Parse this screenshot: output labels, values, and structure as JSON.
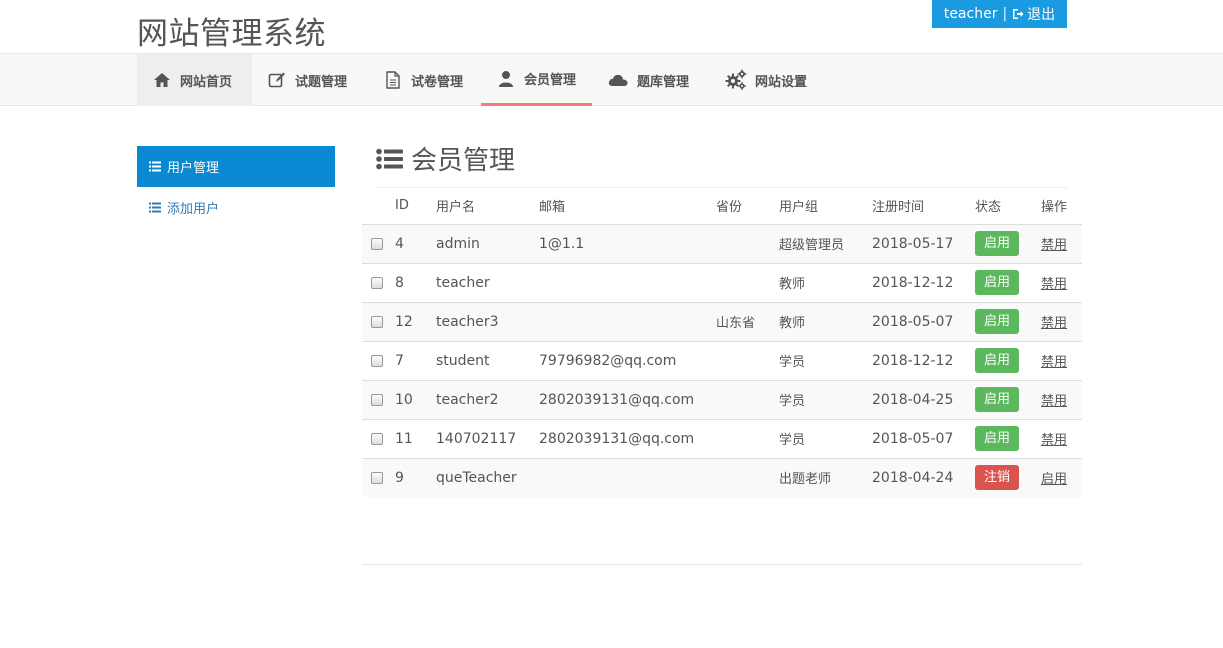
{
  "site_title": "网站管理系统",
  "user": {
    "name": "teacher",
    "separator": "|",
    "logout_label": "退出"
  },
  "nav": [
    {
      "label": "网站首页",
      "icon": "home-icon"
    },
    {
      "label": "试题管理",
      "icon": "edit-icon"
    },
    {
      "label": "试卷管理",
      "icon": "file-icon"
    },
    {
      "label": "会员管理",
      "icon": "user-icon"
    },
    {
      "label": "题库管理",
      "icon": "cloud-icon"
    },
    {
      "label": "网站设置",
      "icon": "gears-icon"
    }
  ],
  "sidebar": [
    {
      "label": "用户管理"
    },
    {
      "label": "添加用户"
    }
  ],
  "page_heading": "会员管理",
  "table": {
    "headers": [
      "ID",
      "用户名",
      "邮箱",
      "省份",
      "用户组",
      "注册时间",
      "状态",
      "操作"
    ],
    "rows": [
      {
        "id": "4",
        "username": "admin",
        "email": "1@1.1",
        "province": "",
        "group": "超级管理员",
        "date": "2018-05-17",
        "status": "启用",
        "status_type": "on",
        "action": "禁用"
      },
      {
        "id": "8",
        "username": "teacher",
        "email": "",
        "province": "",
        "group": "教师",
        "date": "2018-12-12",
        "status": "启用",
        "status_type": "on",
        "action": "禁用"
      },
      {
        "id": "12",
        "username": "teacher3",
        "email": "",
        "province": "山东省",
        "group": "教师",
        "date": "2018-05-07",
        "status": "启用",
        "status_type": "on",
        "action": "禁用"
      },
      {
        "id": "7",
        "username": "student",
        "email": "79796982@qq.com",
        "province": "",
        "group": "学员",
        "date": "2018-12-12",
        "status": "启用",
        "status_type": "on",
        "action": "禁用"
      },
      {
        "id": "10",
        "username": "teacher2",
        "email": "2802039131@qq.com",
        "province": "",
        "group": "学员",
        "date": "2018-04-25",
        "status": "启用",
        "status_type": "on",
        "action": "禁用"
      },
      {
        "id": "11",
        "username": "140702117",
        "email": "2802039131@qq.com",
        "province": "",
        "group": "学员",
        "date": "2018-05-07",
        "status": "启用",
        "status_type": "on",
        "action": "禁用"
      },
      {
        "id": "9",
        "username": "queTeacher",
        "email": "",
        "province": "",
        "group": "出题老师",
        "date": "2018-04-24",
        "status": "注销",
        "status_type": "off",
        "action": "启用"
      }
    ]
  },
  "colors": {
    "accent": "#0a89d2",
    "user_box": "#1a9ae0",
    "active_tab_underline": "#f08070",
    "status_on": "#5cb85c",
    "status_off": "#d9534f"
  }
}
